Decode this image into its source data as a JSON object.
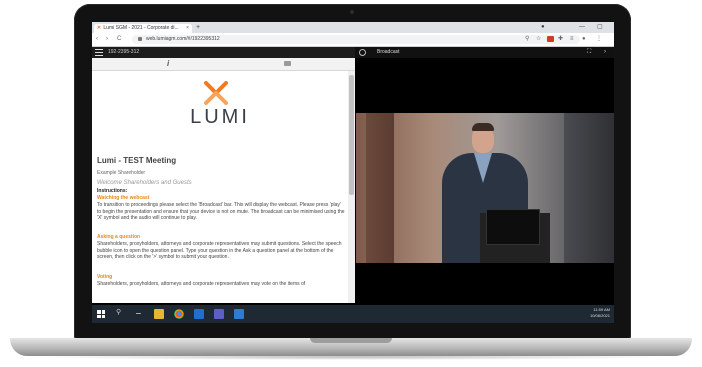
{
  "browser": {
    "tab_title": "Lumi SGM - 2021 - Corporate di...",
    "tab_close": "×",
    "new_tab": "+",
    "url": "web.lumiagm.com/#/1922395312",
    "min_label": "—",
    "max_label": "▢",
    "back": "‹",
    "forward": "›",
    "reload": "C"
  },
  "app": {
    "meeting_id": "192-2395-312",
    "info_tab": "i",
    "broadcast_label": "Broadcast",
    "logo_text": "LUMI",
    "meeting_title": "Lumi - TEST Meeting",
    "user_label": "Example Shareholder",
    "welcome": "Welcome Shareholders and Guests",
    "instructions_label": "Instructions:",
    "s1_title": "Watching the webcast",
    "s1_body": "To transition to proceedings please select the 'Broadcast' bar. This will display the webcast. Please press 'play' to begin the presentation and ensure that your device is not on mute. The broadcast can be minimised using the 'X' symbol and the audio will continue to play.",
    "s2_title": "Asking a question",
    "s2_body": "Shareholders, proxyholders, attorneys and corporate representatives may submit questions. Select the speech bubble icon to open the question panel. Type your question in the Ask a question panel at the bottom of the screen, then click on the '>' symbol to submit your question.",
    "s3_title": "Voting",
    "s3_body": "Shareholders, proxyholders, attorneys and corporate representatives may vote on the items of"
  },
  "taskbar": {
    "time": "11:59 AM",
    "date": "10/08/2021"
  },
  "colors": {
    "lumi_orange": "#f47a20",
    "section_orange": "#e38a21",
    "taskbar": "#1f2933"
  }
}
